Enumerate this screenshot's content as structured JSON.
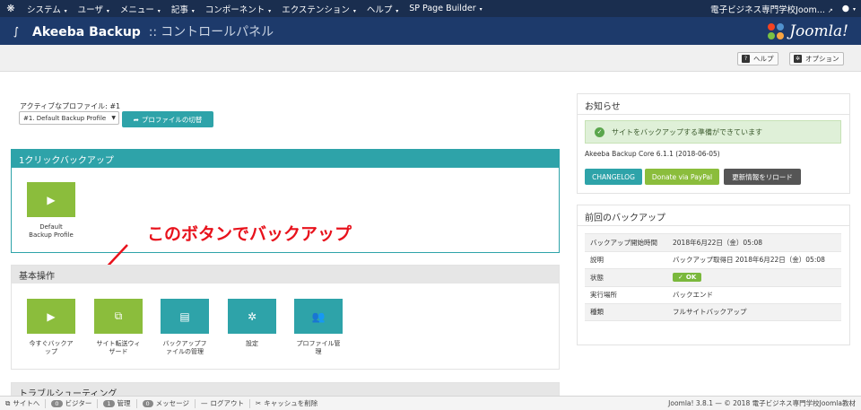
{
  "topnav": {
    "logo_icon": "joomla-icon",
    "menu": [
      {
        "label": "システム"
      },
      {
        "label": "ユーザ"
      },
      {
        "label": "メニュー"
      },
      {
        "label": "記事"
      },
      {
        "label": "コンポーネント"
      },
      {
        "label": "エクステンション"
      },
      {
        "label": "ヘルプ"
      },
      {
        "label": "SP Page Builder"
      }
    ],
    "site_link": "電子ビジネス専門学校Joom...",
    "user_icon": "user-icon"
  },
  "header": {
    "title": "Akeeba Backup",
    "separator": "::",
    "subtitle": "コントロールパネル",
    "brand": "Joomla!"
  },
  "toolbar": {
    "help_label": "ヘルプ",
    "options_label": "オプション"
  },
  "profile": {
    "active_label": "アクティブなプロファイル: #1",
    "selected": "#1. Default Backup Profile",
    "switch_label": "プロファイルの切替"
  },
  "one_click": {
    "heading": "1クリックバックアップ",
    "tile_label_1": "Default",
    "tile_label_2": "Backup Profile"
  },
  "annotation": "このボタンでバックアップ",
  "basic_ops": {
    "heading": "基本操作",
    "items": [
      {
        "label_1": "今すぐバックア",
        "label_2": "ップ",
        "icon": "play-icon",
        "color": "#8bbd3c"
      },
      {
        "label_1": "サイト転送ウィ",
        "label_2": "ザード",
        "icon": "external-link-icon",
        "color": "#8bbd3c"
      },
      {
        "label_1": "バックアップフ",
        "label_2": "ァイルの管理",
        "icon": "file-list-icon",
        "color": "#2ea3a9"
      },
      {
        "label_1": "設定",
        "label_2": "",
        "icon": "gear-icon",
        "color": "#2ea3a9"
      },
      {
        "label_1": "プロファイル管",
        "label_2": "理",
        "icon": "users-icon",
        "color": "#2ea3a9"
      }
    ]
  },
  "troubleshooting": {
    "heading": "トラブルシューティング"
  },
  "news": {
    "heading": "お知らせ",
    "alert": "サイトをバックアップする準備ができています",
    "version": "Akeeba Backup Core 6.1.1 (2018-06-05)",
    "changelog": "CHANGELOG",
    "donate": "Donate via PayPal",
    "reload": "更新情報をリロード"
  },
  "last_backup": {
    "heading": "前回のバックアップ",
    "rows": [
      {
        "key": "バックアップ開始時間",
        "value": "2018年6月22日（金）05:08"
      },
      {
        "key": "説明",
        "value": "バックアップ取得日 2018年6月22日（金）05:08"
      },
      {
        "key": "状態",
        "value": "OK"
      },
      {
        "key": "実行場所",
        "value": "バックエンド"
      },
      {
        "key": "種類",
        "value": "フルサイトバックアップ"
      }
    ]
  },
  "statusbar": {
    "site": "サイトへ",
    "visitors_count": "0",
    "visitors": "ビジター",
    "admins_count": "1",
    "admins": "管理",
    "messages_count": "0",
    "messages": "メッセージ",
    "logout": "ログアウト",
    "clear_cache": "キャッシュを削除",
    "footer": "Joomla! 3.8.1 — © 2018 電子ビジネス専門学校Joomla教材"
  },
  "colors": {
    "nav_bg": "#1a2e4f",
    "header_bg": "#1d3a6b",
    "teal": "#2ea3a9",
    "green": "#8bbd3c",
    "dark_button": "#555555",
    "annotation_red": "#e8121c"
  }
}
